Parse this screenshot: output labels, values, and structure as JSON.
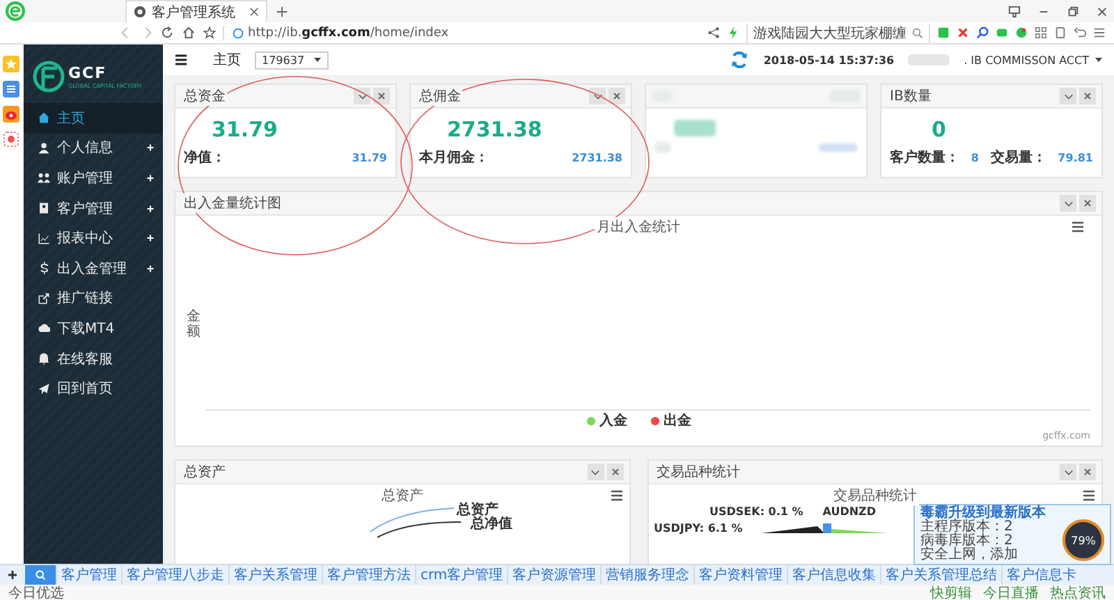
{
  "browser": {
    "tab_title": "客户管理系统",
    "url": "http://ib.**gcffx.com**/home/index",
    "search_text": "游戏陆园大大型玩家棚缠"
  },
  "sidebar": {
    "logo": "GCF",
    "logo_sub": "GLOBAL CAPITAL FACTORY",
    "items": [
      {
        "label": "主页",
        "selected": true,
        "expandable": false
      },
      {
        "label": "个人信息",
        "selected": false,
        "expandable": true
      },
      {
        "label": "账户管理",
        "selected": false,
        "expandable": true
      },
      {
        "label": "客户管理",
        "selected": false,
        "expandable": true
      },
      {
        "label": "报表中心",
        "selected": false,
        "expandable": true
      },
      {
        "label": "出入金管理",
        "selected": false,
        "expandable": true
      },
      {
        "label": "推广链接",
        "selected": false,
        "expandable": false
      },
      {
        "label": "下载MT4",
        "selected": false,
        "expandable": false
      },
      {
        "label": "在线客服",
        "selected": false,
        "expandable": false
      },
      {
        "label": "回到首页",
        "selected": false,
        "expandable": false
      }
    ]
  },
  "header": {
    "home": "主页",
    "account": "179637",
    "datetime": "2018-05-14 15:37:36",
    "user": ". IB COMMISSON ACCT"
  },
  "cards": [
    {
      "kind": "single",
      "title": "总资金",
      "value": "31.79",
      "stats": [
        {
          "label": "净值：",
          "value": "31.79"
        }
      ]
    },
    {
      "kind": "single",
      "title": "总佣金",
      "value": "2731.38",
      "stats": [
        {
          "label": "本月佣金：",
          "value": "2731.38"
        }
      ]
    },
    {
      "kind": "blurred"
    },
    {
      "kind": "double",
      "title": "IB数量",
      "value": "0",
      "stats": [
        {
          "label": "客户数量：",
          "value": "8"
        },
        {
          "label": "交易量：",
          "value": "79.81"
        }
      ]
    }
  ],
  "flow_chart": {
    "panel_title": "出入金量统计图",
    "title": "月出入金统计",
    "ylabel": "金额",
    "legend": [
      {
        "label": "入金",
        "color": "#7ed957"
      },
      {
        "label": "出金",
        "color": "#f04848"
      }
    ],
    "credit": "gcffx.com"
  },
  "assets_panel": {
    "panel_title": "总资产",
    "title": "总资产",
    "labels": [
      "总资产",
      "总净值"
    ]
  },
  "symbols_panel": {
    "panel_title": "交易品种统计",
    "title": "交易品种统计",
    "labels": [
      "USDSEK: 0.1 %",
      "AUDNZD",
      "USDJPY: 6.1 %"
    ]
  },
  "bottom_links": [
    "客户管理",
    "客户管理八步走",
    "客户关系管理",
    "客户管理方法",
    "crm客户管理",
    "客户资源管理",
    "营销服务理念",
    "客户资料管理",
    "客户信息收集",
    "客户关系管理总结",
    "客户信息卡"
  ],
  "status_bar": {
    "left": "今日优选",
    "right": [
      "快剪辑",
      "今日直播",
      "热点资讯"
    ]
  },
  "popup": {
    "title": "毒霸升级到最新版本",
    "lines": [
      "主程序版本：2",
      "病毒库版本：2",
      "安全上网，添加"
    ],
    "gauge": "79%"
  }
}
